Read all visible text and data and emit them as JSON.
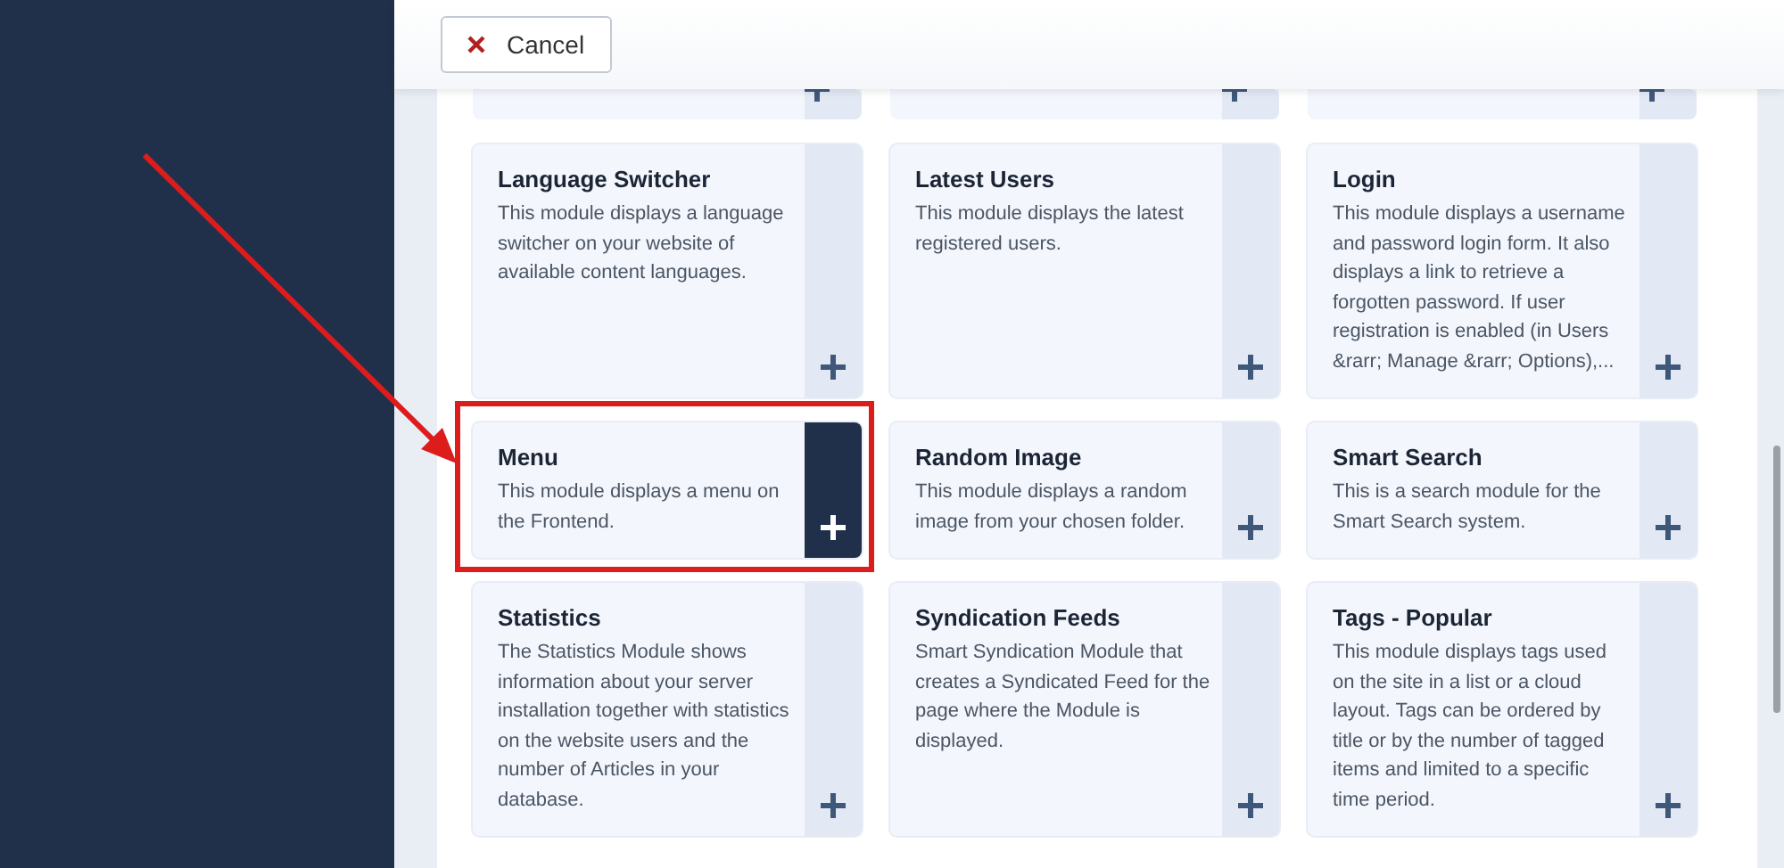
{
  "toolbar": {
    "cancel_button": "Cancel"
  },
  "cut_off_cards": [
    {
      "selected": false
    },
    {
      "selected": false
    },
    {
      "selected": false
    }
  ],
  "modules": [
    {
      "title": "Language Switcher",
      "description": "This module displays a language switcher on your website of available content languages.",
      "selected": false,
      "highlighted": false
    },
    {
      "title": "Latest Users",
      "description": "This module displays the latest registered users.",
      "selected": false,
      "highlighted": false
    },
    {
      "title": "Login",
      "description": "This module displays a username and password login form. It also displays a link to retrieve a forgotten password. If user registration is enabled (in Users &rarr; Manage &rarr; Options),...",
      "selected": false,
      "highlighted": false
    },
    {
      "title": "Menu",
      "description": "This module displays a menu on the Frontend.",
      "selected": true,
      "highlighted": true
    },
    {
      "title": "Random Image",
      "description": "This module displays a random image from your chosen folder.",
      "selected": false,
      "highlighted": false
    },
    {
      "title": "Smart Search",
      "description": "This is a search module for the Smart Search system.",
      "selected": false,
      "highlighted": false
    },
    {
      "title": "Statistics",
      "description": "The Statistics Module shows information about your server installation together with statistics on the website users and the number of Articles in your database.",
      "selected": false,
      "highlighted": false
    },
    {
      "title": "Syndication Feeds",
      "description": "Smart Syndication Module that creates a Syndicated Feed for the page where the Module is displayed.",
      "selected": false,
      "highlighted": false
    },
    {
      "title": "Tags - Popular",
      "description": "This module displays tags used on the site in a list or a cloud layout. Tags can be ordered by title or by the number of tagged items and limited to a specific time period.",
      "selected": false,
      "highlighted": false
    }
  ]
}
